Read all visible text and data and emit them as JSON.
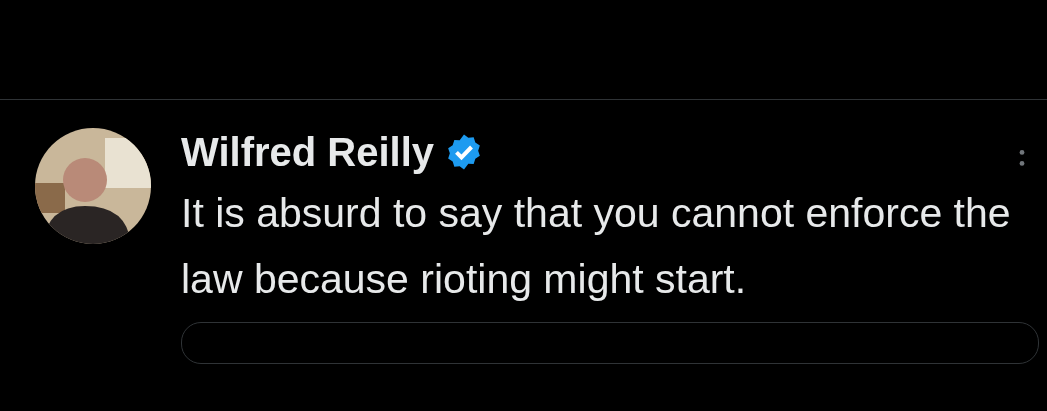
{
  "tweet": {
    "author": {
      "name": "Wilfred Reilly",
      "verified": true
    },
    "text": "It is absurd to say that you cannot enforce the law because rioting might start."
  }
}
